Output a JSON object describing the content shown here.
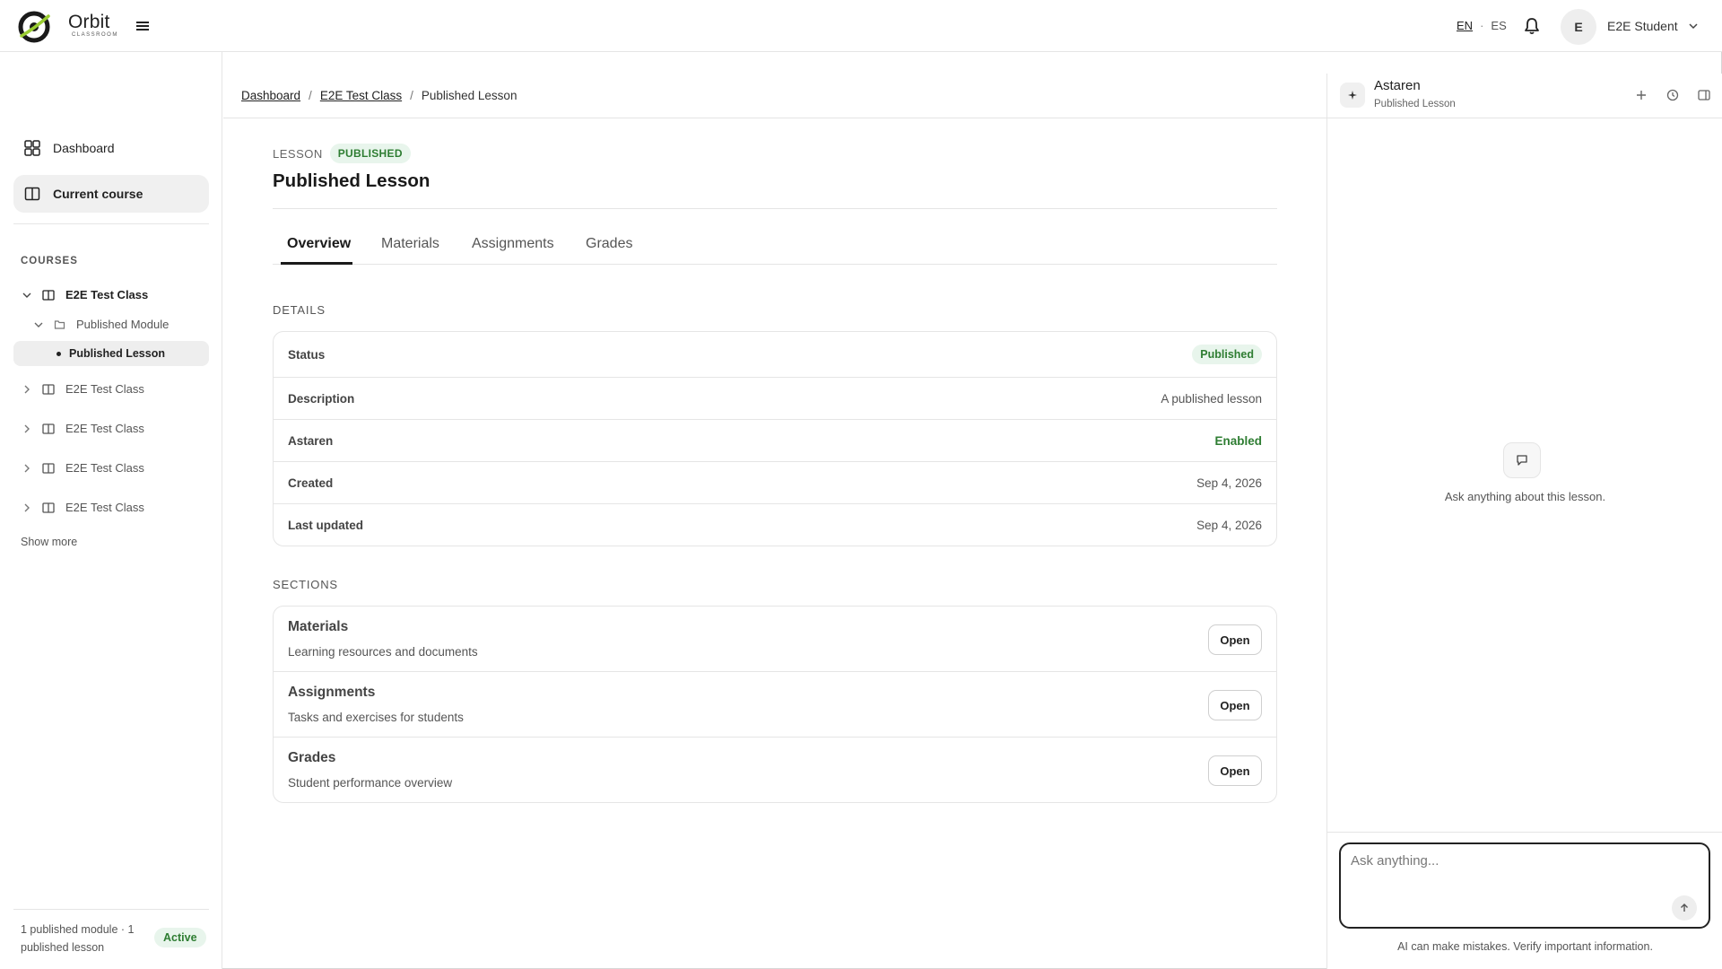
{
  "brand": {
    "name": "Orbit",
    "sub": "CLASSROOM"
  },
  "header": {
    "lang_en": "EN",
    "lang_sep": "·",
    "lang_es": "ES",
    "avatar_initial": "E",
    "user_name": "E2E Student"
  },
  "sidebar": {
    "nav": [
      {
        "label": "Dashboard"
      },
      {
        "label": "Current course"
      }
    ],
    "courses_label": "COURSES",
    "course_open": {
      "label": "E2E Test Class",
      "module": "Published Module",
      "lesson": "Published Lesson"
    },
    "other_courses": [
      {
        "label": "E2E Test Class"
      },
      {
        "label": "E2E Test Class"
      },
      {
        "label": "E2E Test Class"
      },
      {
        "label": "E2E Test Class"
      }
    ],
    "show_more": "Show more",
    "footer_text": "1 published module · 1 published lesson",
    "footer_badge": "Active"
  },
  "breadcrumb": {
    "items": [
      "Dashboard",
      "E2E Test Class"
    ],
    "sep": "/",
    "current": "Published Lesson"
  },
  "lesson": {
    "kicker": "LESSON",
    "badge": "PUBLISHED",
    "title": "Published Lesson",
    "tabs": [
      {
        "label": "Overview"
      },
      {
        "label": "Materials"
      },
      {
        "label": "Assignments"
      },
      {
        "label": "Grades"
      }
    ],
    "active_tab": "Overview"
  },
  "details": {
    "label": "DETAILS",
    "rows": [
      {
        "key": "Status",
        "value": "Published"
      },
      {
        "key": "Description",
        "value": "A published lesson"
      },
      {
        "key": "Astaren",
        "value": "Enabled"
      },
      {
        "key": "Created",
        "value": "Sep 4, 2026"
      },
      {
        "key": "Last updated",
        "value": "Sep 4, 2026"
      }
    ]
  },
  "sections": {
    "label": "SECTIONS",
    "items": [
      {
        "title": "Materials",
        "desc": "Learning resources and documents",
        "button": "Open"
      },
      {
        "title": "Assignments",
        "desc": "Tasks and exercises for students",
        "button": "Open"
      },
      {
        "title": "Grades",
        "desc": "Student performance overview",
        "button": "Open"
      }
    ]
  },
  "assistant": {
    "name": "Astaren",
    "context": "Published Lesson",
    "empty_text": "Ask anything about this lesson.",
    "placeholder": "Ask anything...",
    "disclaimer": "AI can make mistakes. Verify important information."
  },
  "colors": {
    "accent_green": "#2e7d32",
    "badge_bg": "#e8f5ec",
    "logo_lime": "#9acd32"
  },
  "icons": [
    "logo-icon",
    "menu-icon",
    "bell-icon",
    "chevron-down-icon",
    "dashboard-grid-icon",
    "book-icon",
    "folder-icon",
    "chevron-right-icon",
    "sparkle-icon",
    "plus-icon",
    "history-icon",
    "sidebar-toggle-icon",
    "chat-bubble-icon",
    "arrow-up-icon"
  ]
}
